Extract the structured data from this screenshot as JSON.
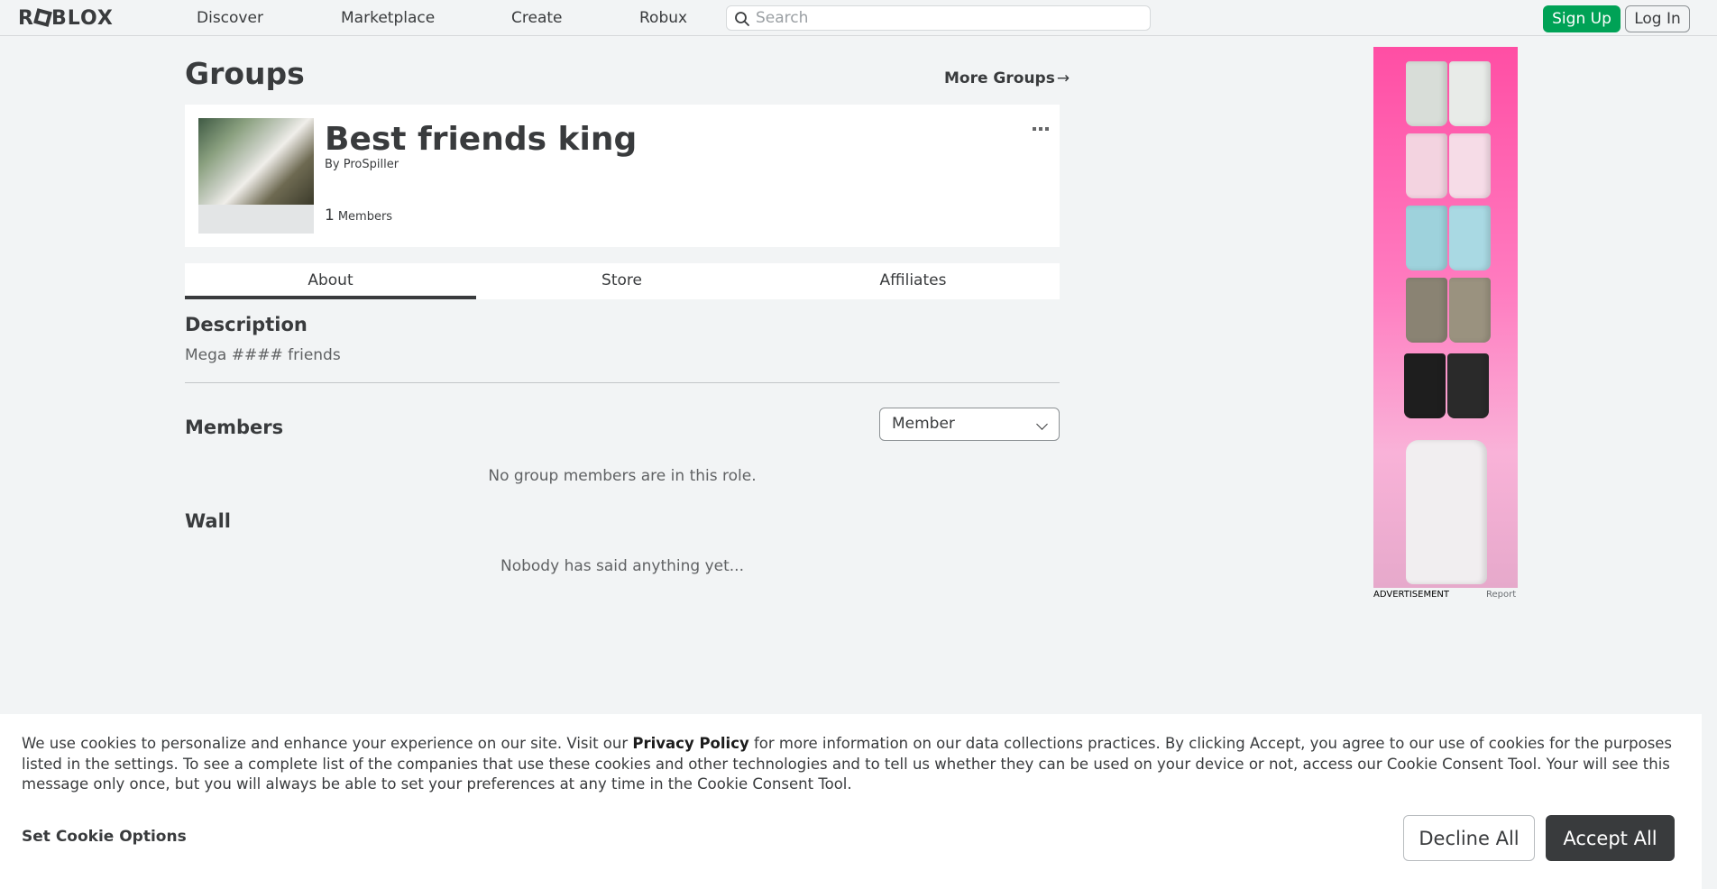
{
  "nav": {
    "logo": "ROBLOX",
    "links": [
      "Discover",
      "Marketplace",
      "Create",
      "Robux"
    ],
    "search_placeholder": "Search",
    "signup_label": "Sign Up",
    "login_label": "Log In"
  },
  "page": {
    "title": "Groups",
    "more_groups_label": "More Groups",
    "more_groups_arrow": "→"
  },
  "group": {
    "name": "Best friends king",
    "by_label": "By",
    "owner": "ProSpiller",
    "member_count": "1",
    "members_label": "Members"
  },
  "tabs": [
    "About",
    "Store",
    "Affiliates"
  ],
  "about": {
    "description_title": "Description",
    "description_text": "Mega #### friends",
    "members_title": "Members",
    "role_selected": "Member",
    "members_empty": "No group members are in this role.",
    "wall_title": "Wall",
    "wall_empty": "Nobody has said anything yet..."
  },
  "ad": {
    "label": "ADVERTISEMENT",
    "report": "Report"
  },
  "cookie": {
    "text_before": "We use cookies to personalize and enhance your experience on our site. Visit our ",
    "policy_link": "Privacy Policy",
    "text_after": " for more information on our data collections practices. By clicking Accept, you agree to our use of cookies for the purposes listed in the settings. To see a complete list of the companies that use these cookies and other technologies and to tell us whether they can be used on your device or not, access our Cookie Consent Tool. Your will see this message only once, but you will always be able to set your preferences at any time in the Cookie Consent Tool.",
    "options_label": "Set Cookie Options",
    "decline_label": "Decline All",
    "accept_label": "Accept All"
  },
  "colors": {
    "signup_green": "#00a256",
    "accept_dark": "#393b3d",
    "ad_pink": "#ff4ea4"
  },
  "icons": [
    "search-icon",
    "arrow-right-icon",
    "more-dots-icon",
    "chevron-down-icon"
  ]
}
